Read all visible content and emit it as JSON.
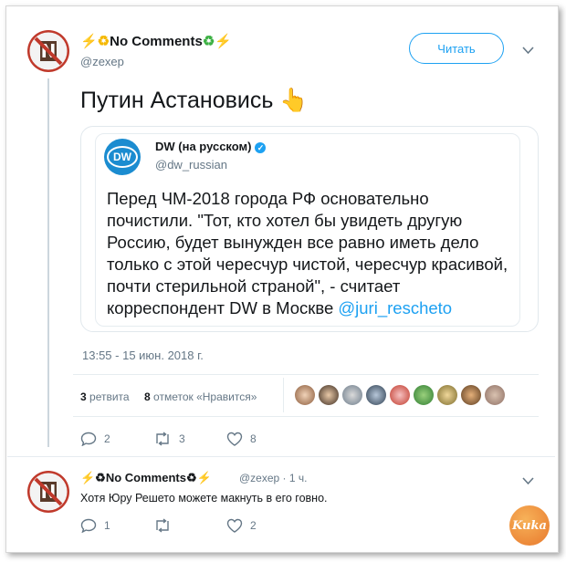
{
  "tweet": {
    "author_name_prefix": "⚡♻",
    "author_name": "No Comments",
    "author_name_suffix": "♻⚡",
    "author_handle": "@zexep",
    "follow_label": "Читать",
    "text": "Путин Астановись 👆",
    "timestamp": "13:55 - 15 июн. 2018 г.",
    "retweets_count": "3",
    "retweets_label": "ретвита",
    "likes_count": "8",
    "likes_label": "отметок «Нравится»",
    "reply_count": "2",
    "retweet_count": "3",
    "like_count": "8"
  },
  "quoted": {
    "logo_text": "DW",
    "name": "DW (на русском)",
    "handle": "@dw_russian",
    "text": "Перед ЧМ-2018 города РФ основательно почистили. \"Тот, кто хотел бы увидеть другую Россию, будет вынужден все равно иметь дело только с этой чересчур чистой, чересчур красивой, почти стерильной страной\", - считает корреспондент DW в Москве",
    "link": "@juri_rescheto"
  },
  "reply": {
    "author_name": "⚡♻No Comments♻⚡",
    "meta": "@zexep · 1 ч.",
    "text": "Хотя Юру Решето можете макнуть в его говно.",
    "reply_count": "1",
    "retweet_count": "",
    "like_count": "2"
  },
  "watermark": "Kuka",
  "colors": {
    "accent": "#1da1f2",
    "muted": "#657786",
    "divider": "#e6ecf0"
  }
}
